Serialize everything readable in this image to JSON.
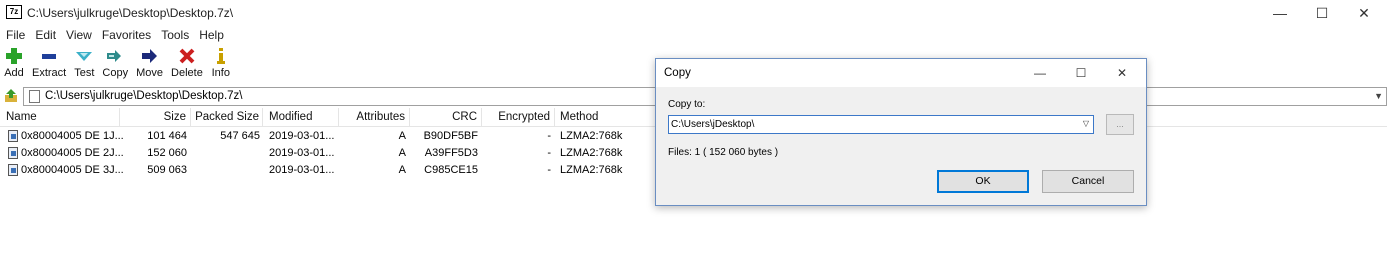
{
  "window": {
    "icon_text": "7z",
    "title": "C:\\Users\\julkruge\\Desktop\\Desktop.7z\\",
    "minimize": "—",
    "maximize": "☐",
    "close": "✕"
  },
  "menu": [
    "File",
    "Edit",
    "View",
    "Favorites",
    "Tools",
    "Help"
  ],
  "toolbar": {
    "items": [
      {
        "label": "Add",
        "icon": "plus-icon",
        "color": "#2aa32a"
      },
      {
        "label": "Extract",
        "icon": "minus-icon",
        "color": "#1f3f9a"
      },
      {
        "label": "Test",
        "icon": "check-chevron-icon",
        "color": "#3ab0c8"
      },
      {
        "label": "Copy",
        "icon": "double-arrow-icon",
        "color": "#2e8b8b"
      },
      {
        "label": "Move",
        "icon": "arrow-right-icon",
        "color": "#1c2a7a"
      },
      {
        "label": "Delete",
        "icon": "x-icon",
        "color": "#cc1f1f"
      },
      {
        "label": "Info",
        "icon": "info-icon",
        "color": "#c8a000"
      }
    ]
  },
  "address": {
    "path": "C:\\Users\\julkruge\\Desktop\\Desktop.7z\\"
  },
  "list": {
    "columns": [
      "Name",
      "Size",
      "Packed Size",
      "Modified",
      "Attributes",
      "CRC",
      "Encrypted",
      "Method"
    ],
    "rows": [
      {
        "name": "0x80004005 DE 1J...",
        "size": "101 464",
        "packed": "547 645",
        "modified": "2019-03-01...",
        "attributes": "A",
        "crc": "B90DF5BF",
        "encrypted": "-",
        "method": "LZMA2:768k"
      },
      {
        "name": "0x80004005 DE 2J...",
        "size": "152 060",
        "packed": "",
        "modified": "2019-03-01...",
        "attributes": "A",
        "crc": "A39FF5D3",
        "encrypted": "-",
        "method": "LZMA2:768k"
      },
      {
        "name": "0x80004005 DE 3J...",
        "size": "509 063",
        "packed": "",
        "modified": "2019-03-01...",
        "attributes": "A",
        "crc": "C985CE15",
        "encrypted": "-",
        "method": "LZMA2:768k"
      }
    ]
  },
  "dialog": {
    "title": "Copy",
    "minimize": "—",
    "maximize": "☐",
    "close": "✕",
    "copy_to_label": "Copy to:",
    "path_value": "C:\\Users\\jDesktop\\",
    "browse_label": "...",
    "files_info": "Files: 1   ( 152 060 bytes )",
    "ok_label": "OK",
    "cancel_label": "Cancel"
  }
}
